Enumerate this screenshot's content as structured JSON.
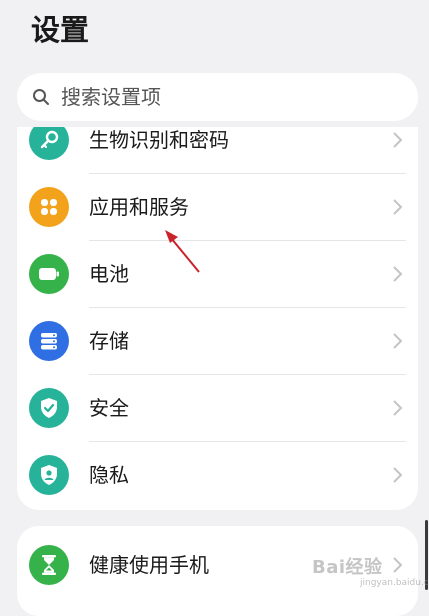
{
  "header": {
    "title": "设置"
  },
  "search": {
    "placeholder": "搜索设置项",
    "icon": "search-icon"
  },
  "settings_group_1": [
    {
      "label": "生物识别和密码",
      "icon": "key-icon",
      "color": "#27b39a"
    },
    {
      "label": "应用和服务",
      "icon": "apps-grid-icon",
      "color": "#f2a21b"
    },
    {
      "label": "电池",
      "icon": "battery-icon",
      "color": "#35b34a"
    },
    {
      "label": "存储",
      "icon": "storage-icon",
      "color": "#2f6fe3"
    },
    {
      "label": "安全",
      "icon": "shield-check-icon",
      "color": "#27b39a"
    },
    {
      "label": "隐私",
      "icon": "privacy-person-icon",
      "color": "#27b39a"
    }
  ],
  "settings_group_2": [
    {
      "label": "健康使用手机",
      "icon": "hourglass-icon",
      "color": "#35b34a"
    }
  ],
  "watermark": {
    "text": "Bai经验",
    "subtext": "jingyan.baidu.com"
  },
  "annotation": {
    "arrow_color": "#c8242a"
  }
}
